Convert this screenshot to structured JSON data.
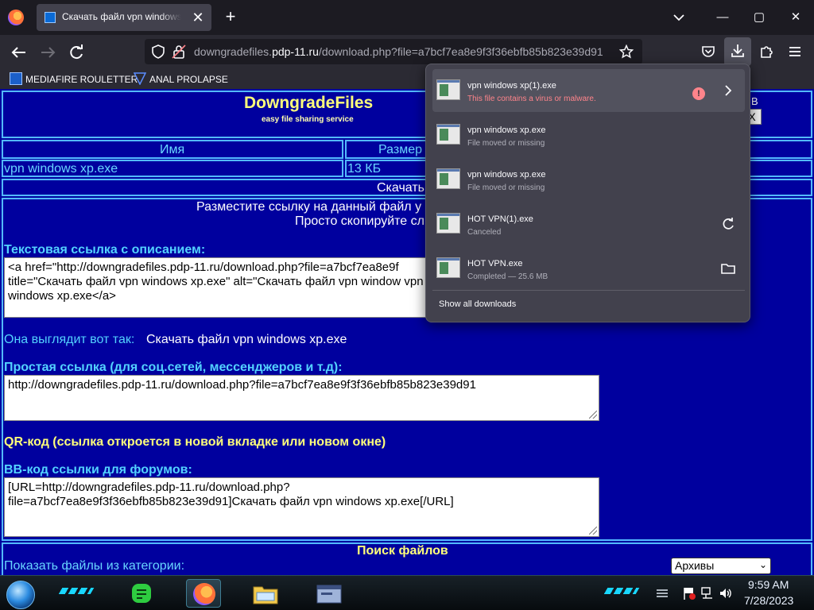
{
  "browser": {
    "tab_title": "Скачать файл vpn windows xp.exe",
    "tab_close": "✕",
    "new_tab": "+",
    "window_controls": {
      "minimize": "—",
      "maximize": "▢",
      "close": "✕"
    },
    "url": {
      "prefix": "downgradefiles.",
      "host": "pdp-11.ru",
      "path": "/download.php?file=a7bcf7ea8e9f3f36ebfb85b823e39d91"
    },
    "bookmarks": [
      {
        "label": "MEDIAFIRE ROULETTER",
        "icon": "mediafire-icon"
      },
      {
        "label": "ANAL PROLAPSE",
        "icon": "bookmark-triangle-icon"
      }
    ]
  },
  "site": {
    "logo_title": "DowngradeFiles",
    "logo_subtitle": "easy file sharing service",
    "corner_fragment": "В",
    "corner_button": "X",
    "table": {
      "headers": [
        "Имя",
        "Размер"
      ],
      "row": {
        "name": "vpn windows xp.exe",
        "size": "13 КБ"
      },
      "download_label": "Скачать"
    },
    "share_line1": "Разместите ссылку на данный файл у",
    "share_line2": "Просто скопируйте сл",
    "text_link_label": "Текстовая ссылка с описанием:",
    "text_link_value": "<a href=\"http://downgradefiles.pdp-11.ru/download.php?file=a7bcf7ea8e9f title=\"Скачать файл vpn windows xp.exe\" alt=\"Скачать файл vpn window vpn windows xp.exe</a>",
    "preview_label": "Она выглядит вот так:",
    "preview_link": "Скачать файл vpn windows xp.exe",
    "simple_link_label": "Простая ссылка (для соц.сетей, мессенджеров и т.д):",
    "simple_link_value": "http://downgradefiles.pdp-11.ru/download.php?file=a7bcf7ea8e9f3f36ebfb85b823e39d91",
    "qr_label": "QR-код (ссылка откроется в новой вкладке или новом окне)",
    "bbcode_label": "BB-код ссылки для форумов:",
    "bbcode_value": "[URL=http://downgradefiles.pdp-11.ru/download.php?file=a7bcf7ea8e9f3f36ebfb85b823e39d91]Скачать файл vpn windows xp.exe[/URL]",
    "search_title": "Поиск файлов",
    "category_label": "Показать файлы из категории:",
    "category_selected": "Архивы"
  },
  "downloads": {
    "items": [
      {
        "name": "vpn windows xp(1).exe",
        "status": "This file contains a virus or malware.",
        "state": "danger",
        "action_icon": "chevron-right-icon"
      },
      {
        "name": "vpn windows xp.exe",
        "status": "File moved or missing",
        "state": "missing",
        "action_icon": ""
      },
      {
        "name": "vpn windows xp.exe",
        "status": "File moved or missing",
        "state": "missing",
        "action_icon": ""
      },
      {
        "name": "HOT VPN(1).exe",
        "status": "Canceled",
        "state": "canceled",
        "action_icon": "retry-icon"
      },
      {
        "name": "HOT VPN.exe",
        "status": "Completed — 25.6 MB",
        "state": "completed",
        "action_icon": "folder-icon"
      }
    ],
    "show_all": "Show all downloads",
    "warning_glyph": "!"
  },
  "taskbar": {
    "time": "9:59 AM",
    "date": "7/28/2023"
  },
  "colors": {
    "page_bg": "#00009e",
    "border": "#53b9ff",
    "accent_yellow": "#ffff7a",
    "danger": "#ff848b"
  }
}
